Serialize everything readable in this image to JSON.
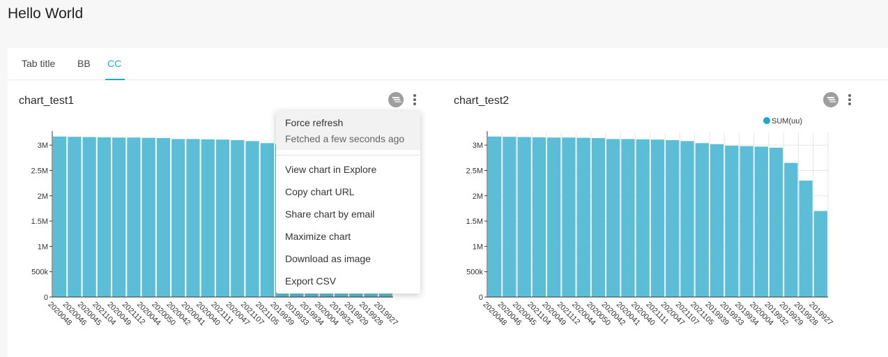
{
  "page": {
    "title": "Hello World"
  },
  "tabs": [
    {
      "label": "Tab title",
      "active": false
    },
    {
      "label": "BB",
      "active": false
    },
    {
      "label": "CC",
      "active": true
    }
  ],
  "menu": {
    "force_refresh": "Force refresh",
    "fetched": "Fetched a few seconds ago",
    "items": [
      "View chart in Explore",
      "Copy chart URL",
      "Share chart by email",
      "Maximize chart",
      "Download as image",
      "Export CSV"
    ]
  },
  "icons": {
    "filter": "filter-icon",
    "more": "kebab-icon"
  },
  "colors": {
    "accent": "#20a7c9",
    "bar": "#5bbdd6"
  },
  "chart_data": [
    {
      "type": "bar",
      "title": "chart_test1",
      "categories": [
        "2020048",
        "2020046",
        "2020045",
        "2021104",
        "2020049",
        "2021112",
        "2020044",
        "2020050",
        "2020042",
        "2020041",
        "2020040",
        "2021111",
        "2020047",
        "2021107",
        "2021105",
        "2019939",
        "2019933",
        "2019934",
        "2020004",
        "2019932",
        "2019929",
        "2019928",
        "2019927"
      ],
      "series": [
        {
          "values": [
            3170000,
            3165000,
            3160000,
            3155000,
            3150000,
            3150000,
            3145000,
            3140000,
            3120000,
            3120000,
            3115000,
            3110000,
            3100000,
            3080000,
            3040000,
            3020000,
            2990000,
            2980000,
            2970000,
            2950000,
            2650000,
            2300000,
            1700000
          ]
        }
      ],
      "yticks": [
        "0",
        "500k",
        "1M",
        "1.5M",
        "2M",
        "2.5M",
        "3M"
      ],
      "ylim": [
        0,
        3250000
      ],
      "grid": false
    },
    {
      "type": "bar",
      "title": "chart_test2",
      "categories": [
        "2020048",
        "2020046",
        "2020045",
        "2021104",
        "2020049",
        "2021112",
        "2020044",
        "2020050",
        "2020042",
        "2020041",
        "2020040",
        "2021111",
        "2020047",
        "2021107",
        "2021105",
        "2019939",
        "2019933",
        "2019934",
        "2020004",
        "2019932",
        "2019929",
        "2019928",
        "2019927"
      ],
      "series": [
        {
          "name": "SUM(uu)",
          "values": [
            3170000,
            3165000,
            3160000,
            3155000,
            3150000,
            3150000,
            3145000,
            3140000,
            3120000,
            3120000,
            3115000,
            3110000,
            3100000,
            3080000,
            3040000,
            3020000,
            2990000,
            2980000,
            2970000,
            2950000,
            2650000,
            2300000,
            1700000
          ]
        }
      ],
      "yticks": [
        "0",
        "500k",
        "1M",
        "1.5M",
        "2M",
        "2.5M",
        "3M"
      ],
      "ylim": [
        0,
        3250000
      ],
      "grid": true,
      "legend": "top-right"
    }
  ]
}
